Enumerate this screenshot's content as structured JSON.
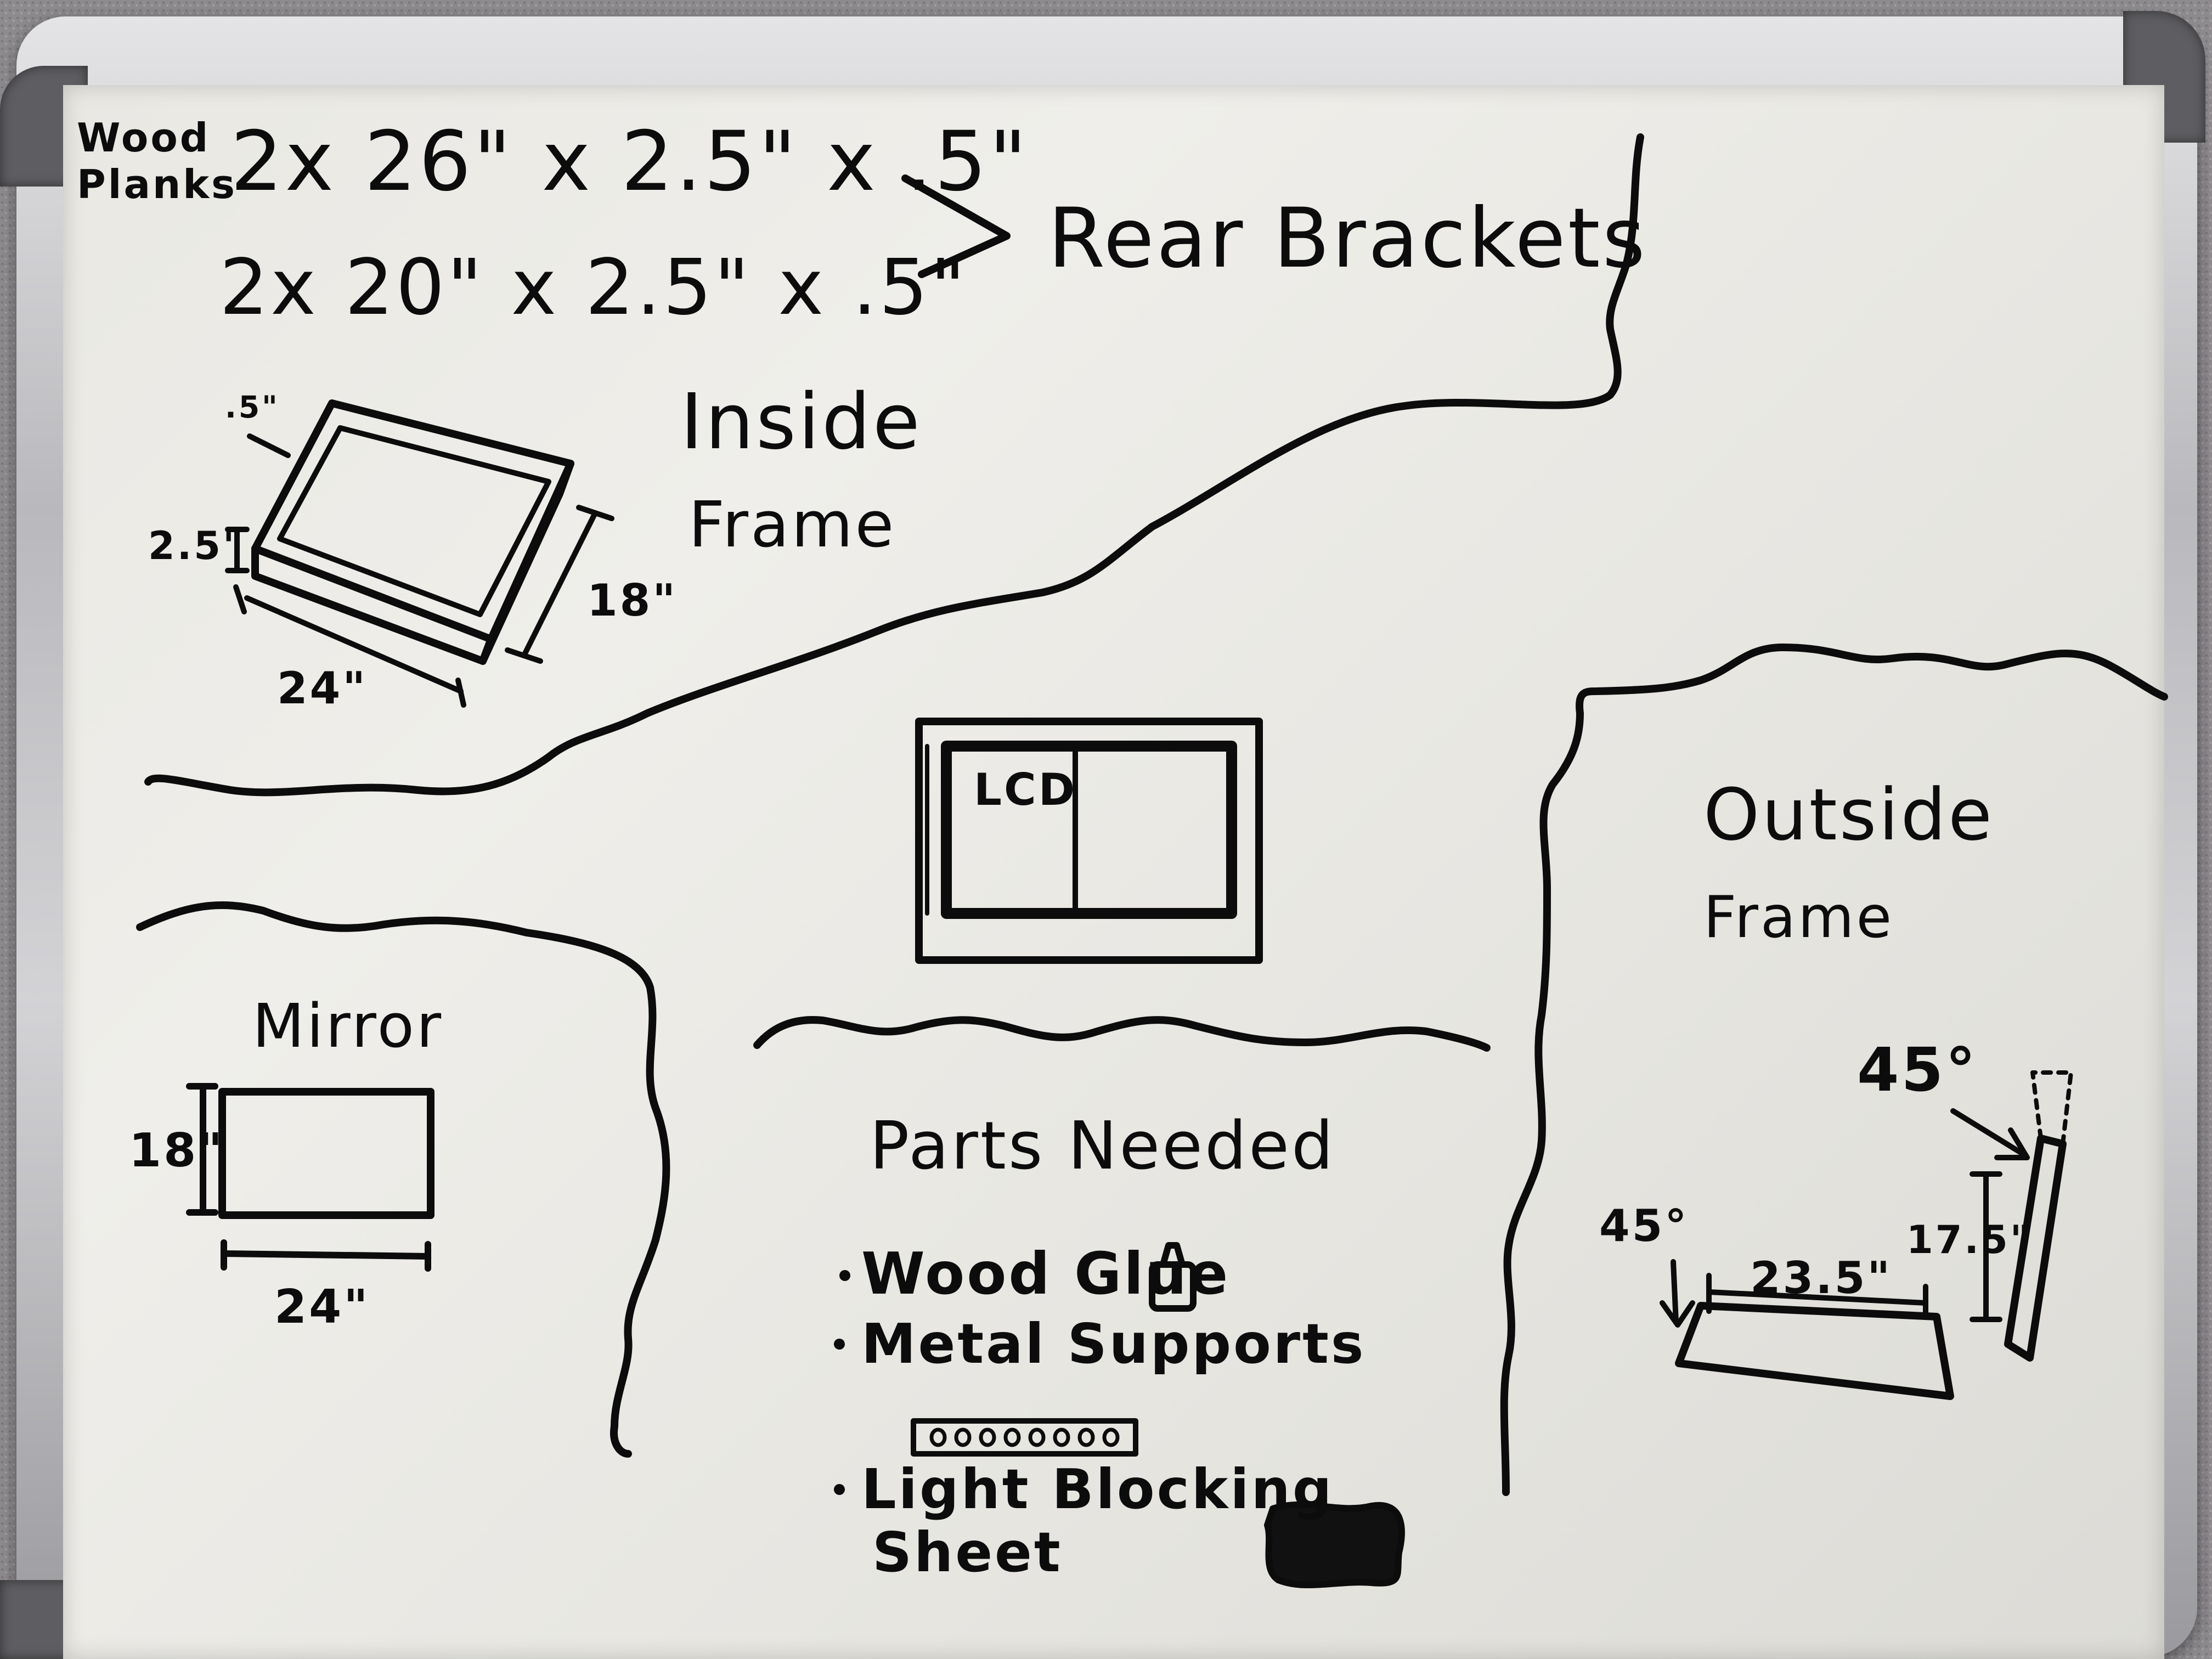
{
  "board": {
    "frame_color": "#c7c7ca",
    "surface_color": "#ebeae6",
    "ink_color": "#0c0c0c"
  },
  "rear_brackets": {
    "materials_label_line1": "Wood",
    "materials_label_line2": "Planks",
    "plank_row_1": "2x  26\" x 2.5\" x .5\"",
    "plank_row_2": "2x  20\" x 2.5\" x .5\"",
    "title": "Rear Brackets"
  },
  "inside_frame": {
    "title_line1": "Inside",
    "title_line2": "Frame",
    "thickness": ".5\"",
    "height": "2.5\"",
    "depth": "18\"",
    "width": "24\""
  },
  "lcd": {
    "label": "LCD"
  },
  "outside_frame": {
    "title_line1": "Outside",
    "title_line2": "Frame",
    "angle_top": "45°",
    "angle_left": "45°",
    "length_long": "23.5\"",
    "length_short": "17.5\""
  },
  "mirror": {
    "title": "Mirror",
    "height": "18\"",
    "width": "24\""
  },
  "parts_needed": {
    "title": "Parts Needed",
    "items": [
      "Wood Glue",
      "Metal Supports",
      "Light Blocking",
      "Sheet"
    ]
  },
  "icons": {
    "glue": "glue-bottle-icon",
    "support": "metal-support-strip-icon",
    "sheet": "light-blocking-sheet-icon"
  }
}
